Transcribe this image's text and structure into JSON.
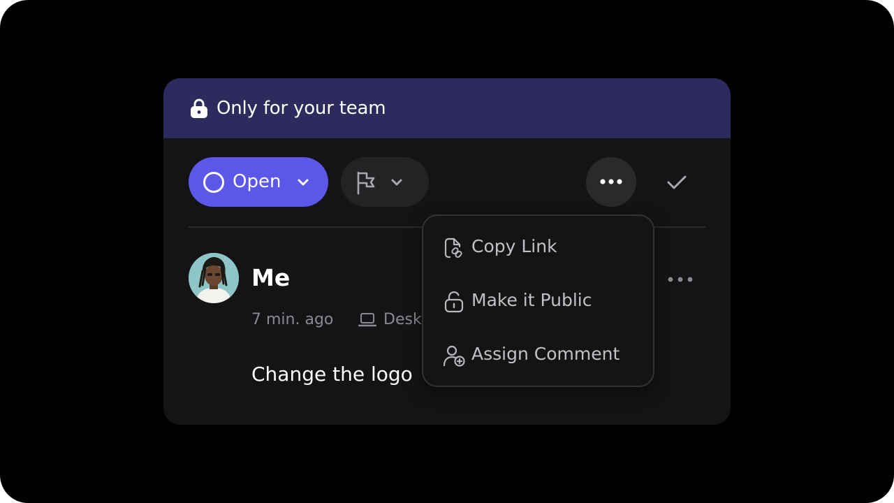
{
  "banner": {
    "icon": "lock-icon",
    "text": "Only for your team",
    "background": "#2d2a5e"
  },
  "toolbar": {
    "status": {
      "label": "Open",
      "color": "#5b57e8",
      "icon": "circle-outline-icon",
      "chevron": "chevron-down-icon"
    },
    "priority": {
      "icon": "flag-icon",
      "chevron": "chevron-down-icon"
    },
    "more_icon": "more-horizontal-icon",
    "resolve_icon": "check-icon"
  },
  "comment": {
    "author": "Me",
    "timestamp": "7 min. ago",
    "device_icon": "laptop-icon",
    "device": "Desk",
    "text": "Change the logo",
    "more_icon": "more-horizontal-icon"
  },
  "menu": {
    "items": [
      {
        "label": "Copy Link",
        "icon": "link-icon"
      },
      {
        "label": "Make it Public",
        "icon": "unlock-icon"
      },
      {
        "label": "Assign Comment",
        "icon": "user-plus-icon"
      }
    ]
  }
}
